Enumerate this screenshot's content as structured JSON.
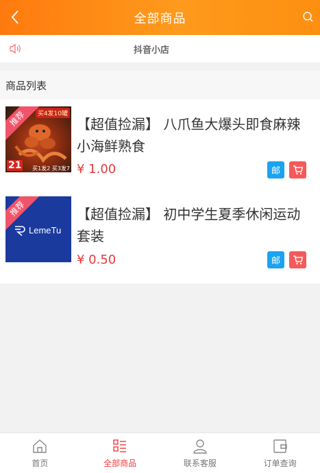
{
  "header": {
    "title": "全部商品"
  },
  "notice": {
    "text": "抖音小店"
  },
  "section": {
    "title": "商品列表"
  },
  "products": [
    {
      "name": "【超值捡漏】 八爪鱼大爆头即食麻辣小海鲜熟食",
      "price": "¥ 1.00",
      "ribbon": "推荐",
      "thumb_text_top": "买4发10罐",
      "thumb_text_corner": "21",
      "thumb_text_bottom": "买1发2 买3发7",
      "mail_label": "邮"
    },
    {
      "name": "【超值捡漏】 初中学生夏季休闲运动套装",
      "price": "¥ 0.50",
      "ribbon": "推荐",
      "thumb_logo": "LemeTu",
      "mail_label": "邮"
    }
  ],
  "tabbar": {
    "items": [
      {
        "label": "首页",
        "icon": "home-icon"
      },
      {
        "label": "全部商品",
        "icon": "category-list-icon",
        "active": true
      },
      {
        "label": "联系客服",
        "icon": "user-icon"
      },
      {
        "label": "订单查询",
        "icon": "wallet-icon"
      }
    ]
  },
  "colors": {
    "accent": "#ff8a12",
    "price": "#e63a3a",
    "mail_badge": "#1aa3f0",
    "cart_badge": "#f55a5a",
    "active_tab": "#ee3a3a"
  }
}
